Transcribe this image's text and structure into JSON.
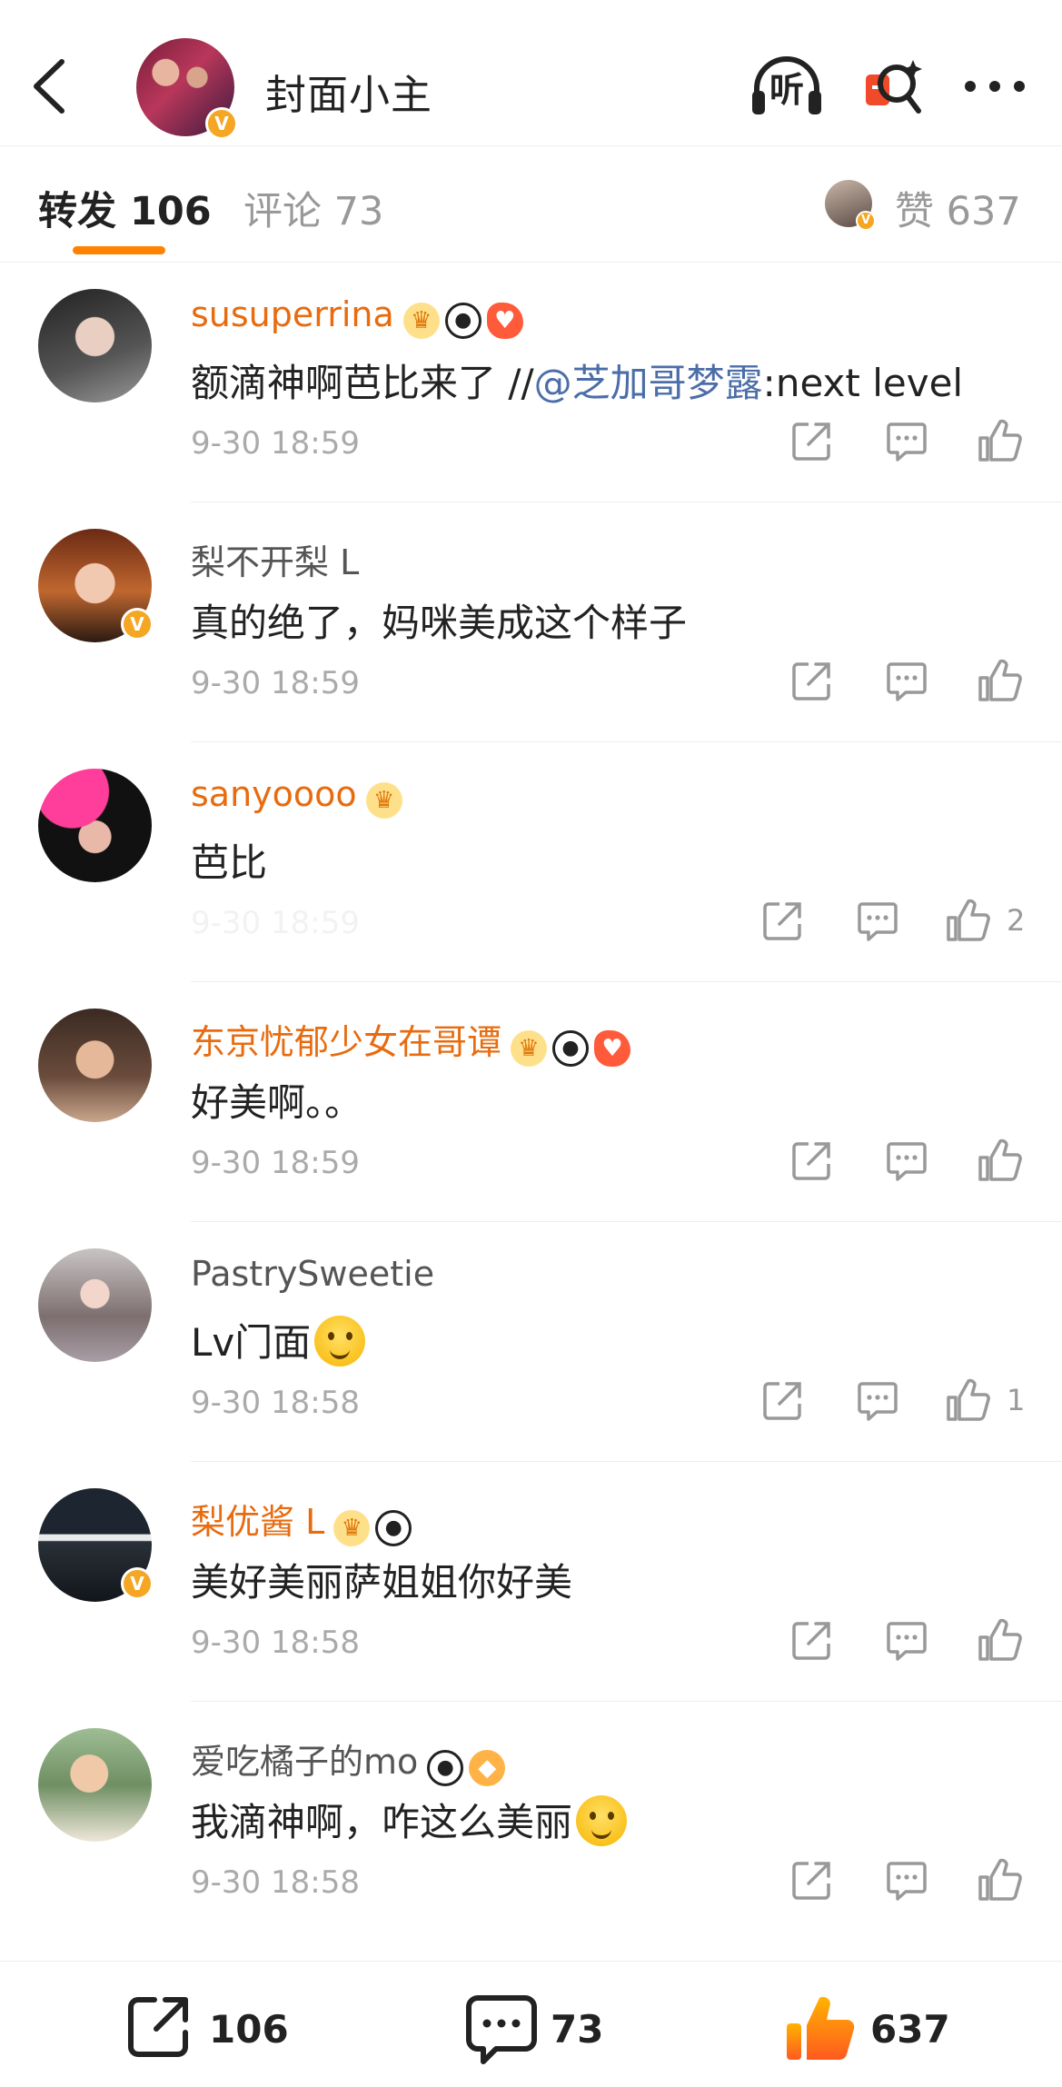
{
  "header": {
    "title": "封面小主",
    "listen_label": "听"
  },
  "tabs": {
    "reposts": "转发 106",
    "comments": "评论 73",
    "likes": "赞 637"
  },
  "comments": [
    {
      "name": "susuperrina",
      "style": "vip",
      "badges": [
        "crown",
        "panda",
        "bird"
      ],
      "text_before": "额滴神啊芭比来了 //",
      "mention": "@芝加哥梦露",
      "text_after": ":next level",
      "time": "9-30 18:59",
      "likes": ""
    },
    {
      "name": "梨不开梨 L",
      "style": "plain",
      "badges": [],
      "text": "真的绝了，妈咪美成这个样子",
      "time": "9-30 18:59",
      "likes": "",
      "verified": true
    },
    {
      "name": "sanyoooo",
      "style": "vip",
      "badges": [
        "crown"
      ],
      "text": "芭比",
      "time": "9-30 18:59",
      "likes": "2"
    },
    {
      "name": "东京忧郁少女在哥谭",
      "style": "vip",
      "badges": [
        "crown",
        "panda",
        "bird"
      ],
      "text": "好美啊。。",
      "time": "9-30 18:59",
      "likes": ""
    },
    {
      "name": "PastrySweetie",
      "style": "plain",
      "badges": [],
      "text": "Lv门面",
      "time": "9-30 18:58",
      "likes": "1",
      "emoji": "wink-face"
    },
    {
      "name": "梨优酱 L",
      "style": "vip",
      "badges": [
        "crown",
        "panda"
      ],
      "text": "美好美丽萨姐姐你好美",
      "time": "9-30 18:58",
      "likes": "",
      "verified": true
    },
    {
      "name": "爱吃橘子的mo",
      "style": "plain",
      "badges": [
        "panda",
        "fish"
      ],
      "text": "我滴神啊，咋这么美丽",
      "time": "9-30 18:58",
      "likes": "",
      "emoji": "heart-face"
    }
  ],
  "bottom_bar": {
    "reposts": "106",
    "comments": "73",
    "likes": "637"
  },
  "colors": {
    "accent": "#ff8200",
    "vip_name": "#e86b0f",
    "mention": "#4b6ea8",
    "muted": "#aaaaaa"
  }
}
